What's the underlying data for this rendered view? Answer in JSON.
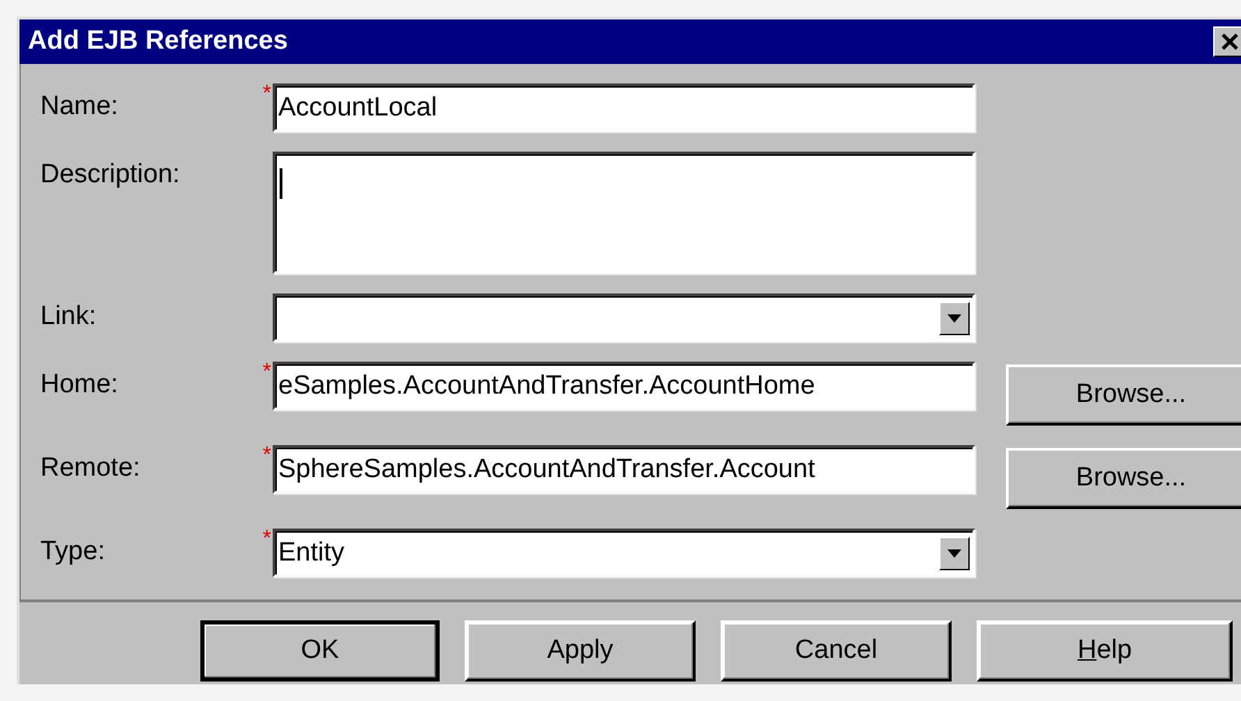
{
  "window": {
    "title": "Add EJB References"
  },
  "fields": [
    {
      "label": "Name:",
      "kind": "text",
      "required_mark": "*",
      "value": "AccountLocal"
    },
    {
      "label": "Description:",
      "kind": "textarea"
    },
    {
      "label": "Link:",
      "kind": "dropdown"
    },
    {
      "label": "Home:",
      "kind": "text",
      "required_mark": "*",
      "value": "eSamples.AccountAndTransfer.AccountHome",
      "browse": "Browse..."
    },
    {
      "label": "Remote:",
      "kind": "text",
      "required_mark": "*",
      "value": "SphereSamples.AccountAndTransfer.Account",
      "browse": "Browse..."
    },
    {
      "label": "Type:",
      "kind": "dropdown",
      "required_mark": "*",
      "value": "Entity"
    }
  ],
  "buttons": [
    {
      "label": "OK",
      "default": true,
      "underline_first": false
    },
    {
      "label": "Apply",
      "default": false,
      "underline_first": false
    },
    {
      "label": "Cancel",
      "default": false,
      "underline_first": false
    },
    {
      "label": "Help",
      "default": false,
      "underline_first": true
    }
  ]
}
